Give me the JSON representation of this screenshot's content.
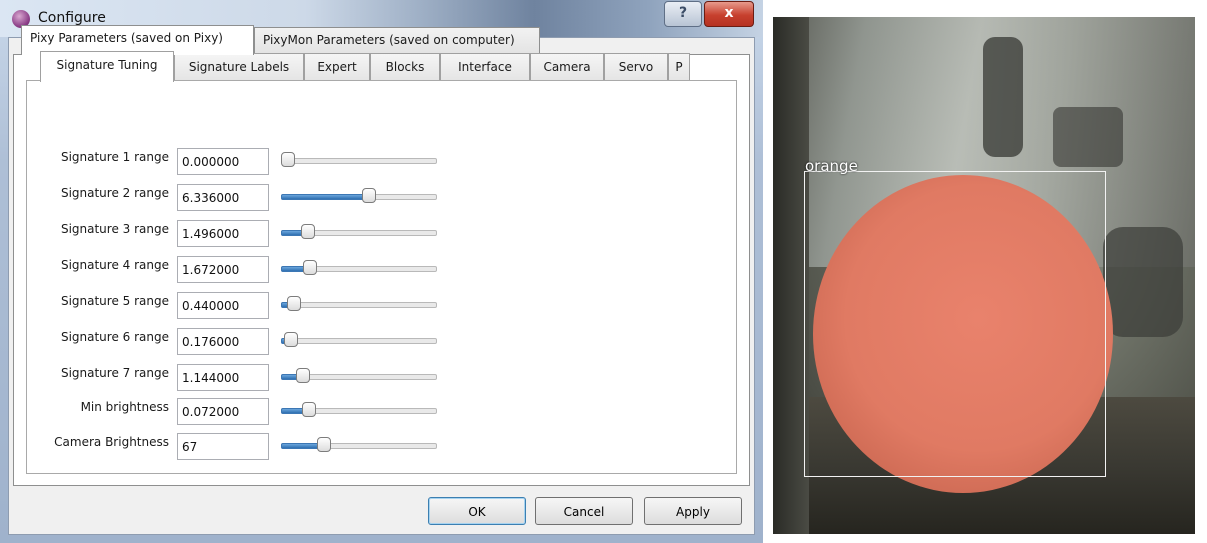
{
  "window": {
    "title": "Configure",
    "help_glyph": "?",
    "close_glyph": "x"
  },
  "outer_tabs": [
    {
      "label": "Pixy Parameters (saved on Pixy)",
      "active": true
    },
    {
      "label": "PixyMon Parameters (saved on computer)",
      "active": false
    }
  ],
  "inner_tabs": [
    {
      "label": "Signature Tuning",
      "active": true
    },
    {
      "label": "Signature Labels",
      "active": false
    },
    {
      "label": "Expert",
      "active": false
    },
    {
      "label": "Blocks",
      "active": false
    },
    {
      "label": "Interface",
      "active": false
    },
    {
      "label": "Camera",
      "active": false
    },
    {
      "label": "Servo",
      "active": false
    },
    {
      "label": "P",
      "active": false
    }
  ],
  "tab_scroll": {
    "left_glyph": "◀",
    "right_glyph": "▶"
  },
  "params": [
    {
      "label": "Signature 1 range",
      "value": "0.000000",
      "slider": 0.0
    },
    {
      "label": "Signature 2 range",
      "value": "6.336000",
      "slider": 0.58
    },
    {
      "label": "Signature 3 range",
      "value": "1.496000",
      "slider": 0.14
    },
    {
      "label": "Signature 4 range",
      "value": "1.672000",
      "slider": 0.16
    },
    {
      "label": "Signature 5 range",
      "value": "0.440000",
      "slider": 0.04
    },
    {
      "label": "Signature 6 range",
      "value": "0.176000",
      "slider": 0.02
    },
    {
      "label": "Signature 7 range",
      "value": "1.144000",
      "slider": 0.11
    },
    {
      "label": "Min brightness",
      "value": "0.072000",
      "slider": 0.15
    },
    {
      "label": "Camera Brightness",
      "value": "67",
      "slider": 0.26
    }
  ],
  "buttons": {
    "ok": "OK",
    "cancel": "Cancel",
    "apply": "Apply"
  },
  "camera": {
    "detection_label": "orange"
  },
  "colors": {
    "slider_fill": "#2f6fb0",
    "detection_blob": "#e07a63",
    "titlebar": "#cdd9e8"
  }
}
